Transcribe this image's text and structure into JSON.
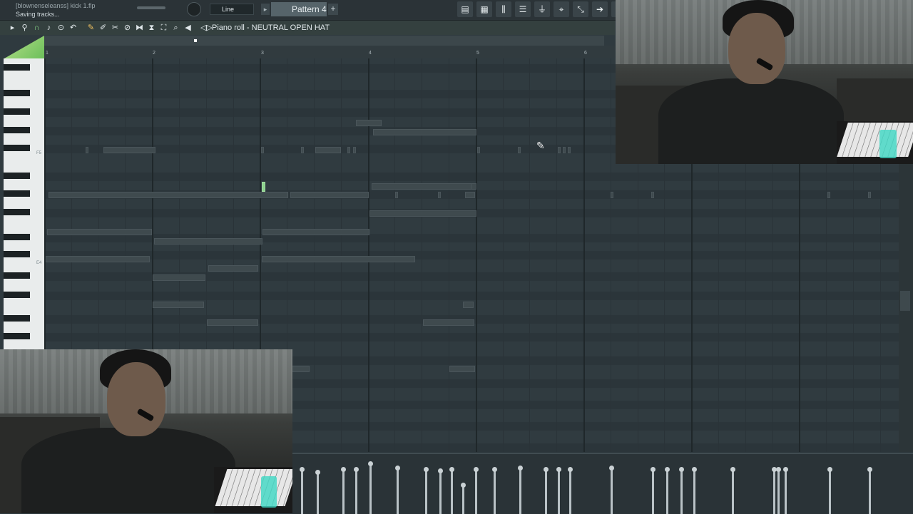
{
  "topbar": {
    "project_name": "[blownenseleanss] kick 1.flp",
    "status": "Saving tracks...",
    "snap_mode": "Line",
    "pattern_name": "Pattern 4",
    "pattern_add": "+",
    "pattern_arrow": "▸"
  },
  "piano_roll": {
    "title": "Piano roll - NEUTRAL OPEN HAT",
    "title_arrow": "◁▷",
    "ruler_numbers": [
      "1",
      "2",
      "3",
      "4",
      "5",
      "6"
    ],
    "key_labels": [
      "F5",
      "E4"
    ]
  },
  "toolbar_icons": [
    "playlist-icon",
    "piano-roll-icon",
    "mixer-icon",
    "channel-rack-icon",
    "plugin-icon",
    "browser-icon",
    "tempo-icon",
    "export-icon",
    "link-icon"
  ],
  "colors": {
    "grid_bg": "#303b40",
    "note": "#3f4a4e",
    "selected_note": "#8bd08b",
    "accent": "#8fe38f"
  }
}
